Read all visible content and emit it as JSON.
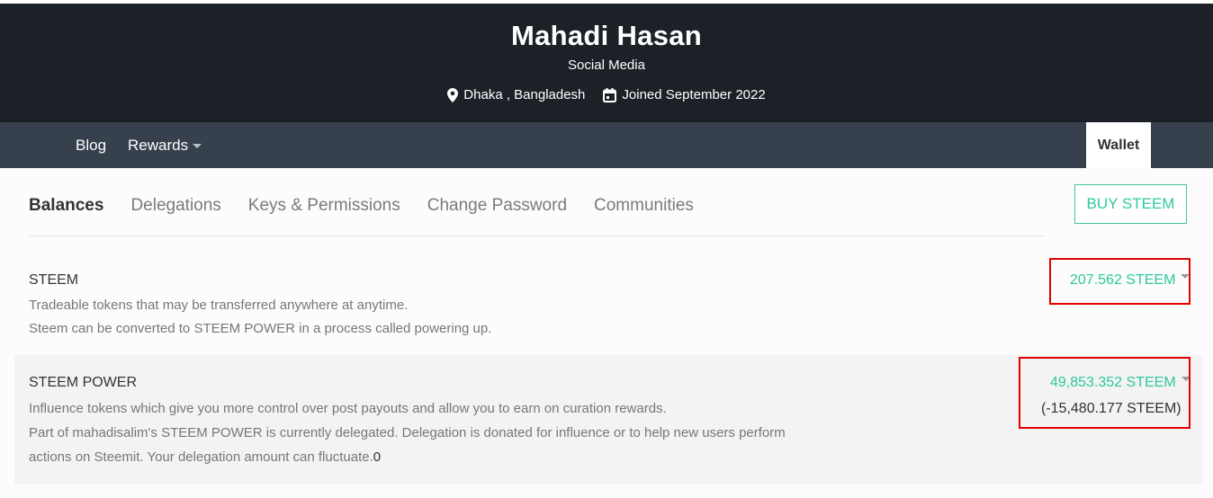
{
  "profile": {
    "name": "Mahadi Hasan",
    "about": "Social Media",
    "location": "Dhaka , Bangladesh",
    "joined": "Joined September 2022"
  },
  "nav": {
    "blog": "Blog",
    "rewards": "Rewards",
    "wallet": "Wallet"
  },
  "wallet_tabs": {
    "balances": "Balances",
    "delegations": "Delegations",
    "keys": "Keys & Permissions",
    "change_password": "Change Password",
    "communities": "Communities"
  },
  "buy_button": "BUY STEEM",
  "steem": {
    "title": "STEEM",
    "desc_1": "Tradeable tokens that may be transferred anywhere at anytime.",
    "desc_2": "Steem can be converted to STEEM POWER in a process called powering up.",
    "amount": "207.562 STEEM"
  },
  "steem_power": {
    "title": "STEEM POWER",
    "desc_1": "Influence tokens which give you more control over post payouts and allow you to earn on curation rewards.",
    "desc_2": "Part of mahadisalim's STEEM POWER is currently delegated. Delegation is donated for influence or to help new users perform",
    "desc_3": "actions on Steemit. Your delegation amount can fluctuate.",
    "desc_3_suffix": "0",
    "amount": "49,853.352 STEEM",
    "delegated": "(-15,480.177 STEEM)"
  },
  "colors": {
    "header_bg": "#1c2127",
    "nav_bg": "#36414d",
    "accent_green": "#2ec99e",
    "highlight_red": "#e00000"
  },
  "icons": {
    "location": "map-pin-icon",
    "calendar": "calendar-icon",
    "rewards_caret": "caret-down-icon",
    "amount_dropdown": "caret-down-icon"
  }
}
